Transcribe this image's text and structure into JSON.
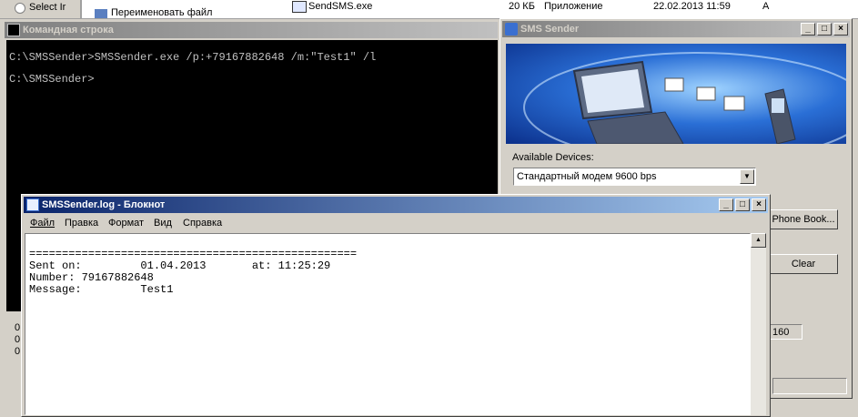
{
  "explorer": {
    "radio_label": "Select Ir",
    "menu_item": "Переименовать файл",
    "file_name": "SendSMS.exe",
    "file_size": "20 КБ",
    "file_type": "Приложение",
    "file_date": "22.02.2013 11:59",
    "file_attr": "A"
  },
  "console": {
    "title": "Командная строка",
    "lines": [
      "C:\\SMSSender>SMSSender.exe /p:+79167882648 /m:\"Test1\" /l",
      "C:\\SMSSender>"
    ]
  },
  "sms": {
    "title": "SMS Sender",
    "devices_label": "Available Devices:",
    "device_value": "Стандартный модем  9600 bps",
    "phonebook_button": "Phone Book...",
    "clear_button": "Clear",
    "counter": "160"
  },
  "notepad": {
    "title": "SMSSender.log - Блокнот",
    "menu": [
      "Файл",
      "Правка",
      "Формат",
      "Вид",
      "Справка"
    ],
    "lines": [
      "==================================================",
      "Sent on:         01.04.2013       at: 11:25:29",
      "Number: 79167882648",
      "Message:         Test1"
    ]
  },
  "left_panel": {
    "items": [
      "0",
      "0",
      "0"
    ]
  },
  "icons": [
    "console-icon",
    "sms-icon",
    "notepad-icon",
    "minimize-icon",
    "maximize-icon",
    "close-icon",
    "dropdown-arrow-icon",
    "scroll-up-icon"
  ]
}
